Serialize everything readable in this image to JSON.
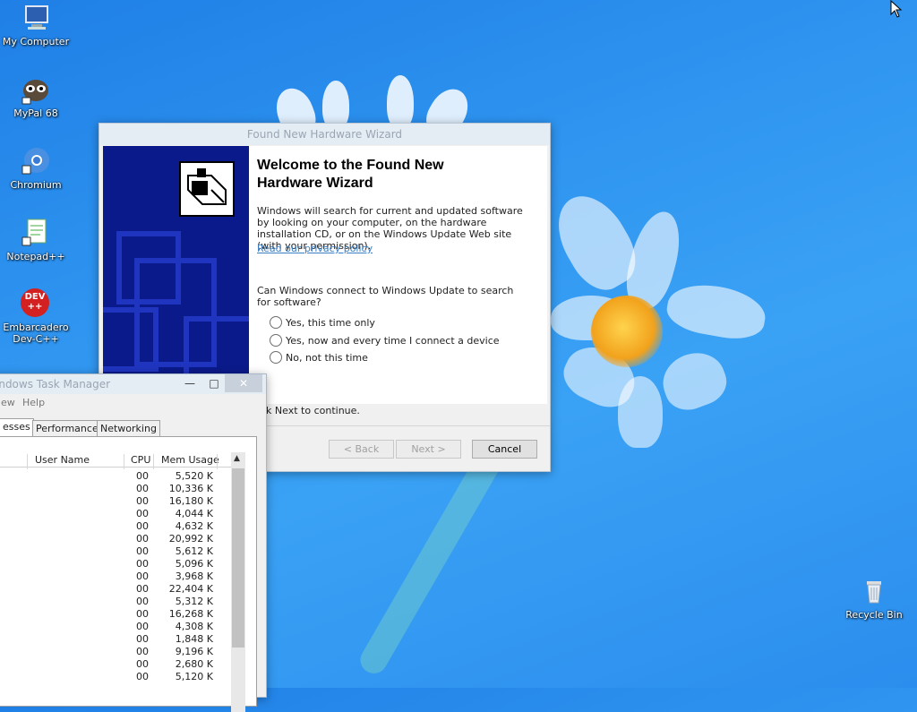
{
  "desktop": {
    "icons": [
      {
        "label": "My Computer",
        "icon": "computer-icon"
      },
      {
        "label": "MyPal 68",
        "icon": "mypal-icon"
      },
      {
        "label": "Chromium",
        "icon": "chromium-icon"
      },
      {
        "label": "Notepad++",
        "icon": "notepadpp-icon"
      },
      {
        "label": "Embarcadero Dev-C++",
        "icon": "devcpp-icon",
        "icon_text": "DEV ++"
      },
      {
        "label": "Recycle Bin",
        "icon": "recycle-bin-icon"
      }
    ]
  },
  "wizard": {
    "title": "Found New Hardware Wizard",
    "heading": "Welcome to the Found New Hardware Wizard",
    "description": "Windows will search for current and updated software by looking on your computer, on the hardware installation CD, or on the Windows Update Web site (with your permission).",
    "privacy_link": "Read our privacy policy",
    "question": "Can Windows connect to Windows Update to search for software?",
    "options": [
      "Yes, this time only",
      "Yes, now and every time I connect a device",
      "No, not this time"
    ],
    "click_next": "ck Next to continue.",
    "buttons": {
      "back": "< Back",
      "next": "Next >",
      "cancel": "Cancel"
    }
  },
  "taskmanager": {
    "title": "indows Task Manager",
    "menu": [
      "ew",
      "Help"
    ],
    "tabs": [
      "esses",
      "Performance",
      "Networking"
    ],
    "columns": {
      "user": "User Name",
      "cpu": "CPU",
      "mem": "Mem Usage"
    },
    "rows": [
      {
        "cpu": "00",
        "mem": "5,520 K"
      },
      {
        "cpu": "00",
        "mem": "10,336 K"
      },
      {
        "cpu": "00",
        "mem": "16,180 K"
      },
      {
        "cpu": "00",
        "mem": "4,044 K"
      },
      {
        "cpu": "00",
        "mem": "4,632 K"
      },
      {
        "cpu": "00",
        "mem": "20,992 K"
      },
      {
        "cpu": "00",
        "mem": "5,612 K"
      },
      {
        "cpu": "00",
        "mem": "5,096 K"
      },
      {
        "cpu": "00",
        "mem": "3,968 K"
      },
      {
        "cpu": "00",
        "mem": "22,404 K"
      },
      {
        "cpu": "00",
        "mem": "5,312 K"
      },
      {
        "cpu": "00",
        "mem": "16,268 K"
      },
      {
        "cpu": "00",
        "mem": "4,308 K"
      },
      {
        "cpu": "00",
        "mem": "1,848 K"
      },
      {
        "cpu": "00",
        "mem": "9,196 K"
      },
      {
        "cpu": "00",
        "mem": "2,680 K"
      },
      {
        "cpu": "00",
        "mem": "5,120 K"
      }
    ]
  },
  "colors": {
    "desktop": "#2f95f0",
    "wizard_side": "#0a1a8a",
    "link": "#3b7fc4"
  }
}
